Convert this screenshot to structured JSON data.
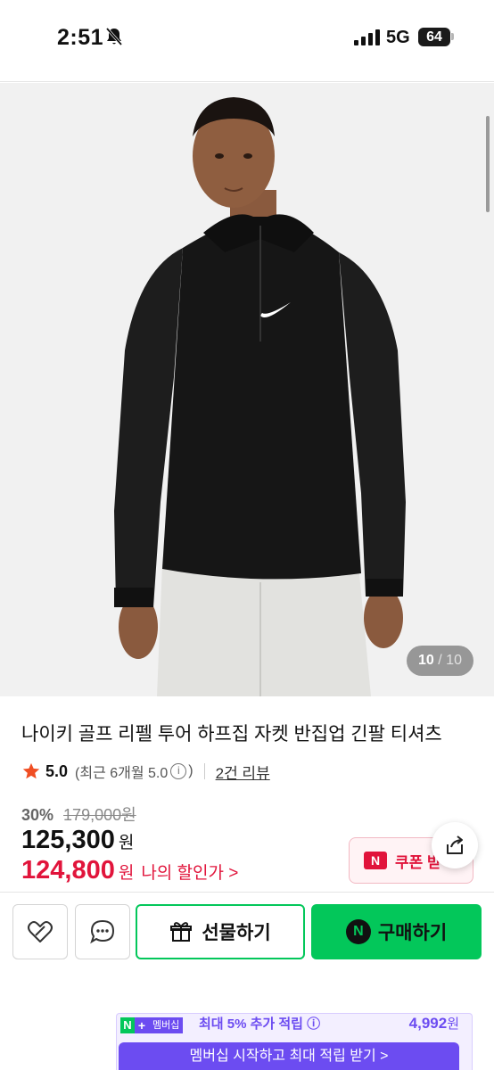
{
  "status_bar": {
    "time": "2:51",
    "network": "5G",
    "battery": "64"
  },
  "gallery": {
    "current": "10",
    "separator": " / ",
    "total": "10"
  },
  "product": {
    "title": "나이키 골프 리펠 투어 하프집 자켓 반집업 긴팔 티셔츠",
    "rating": "5.0",
    "rating_recent": "(최근 6개월 5.0",
    "rating_recent_close": ")",
    "review_link": "2건 리뷰",
    "discount_rate": "30%",
    "original_price": "179,000원",
    "sale_price": "125,300",
    "sale_unit": "원",
    "my_price": "124,800",
    "my_unit": "원",
    "my_price_label": "나의 할인가 >"
  },
  "coupon": {
    "badge": "N",
    "label": "쿠폰 받"
  },
  "actions": {
    "gift_label": "선물하기",
    "buy_label": "구매하기",
    "npay_badge": "N"
  },
  "membership": {
    "badge_n": "N",
    "badge_plus": "+",
    "badge_label": "멤버십",
    "text": "최대 5% 추가 적립 ⓘ",
    "points": "4,992",
    "points_unit": "원",
    "cta": "멤버십 시작하고 최대 적립 받기 >"
  },
  "colors": {
    "naver_green": "#03c75a",
    "price_red": "#e1143b",
    "membership_purple": "#6c4cf1",
    "star_orange": "#f04e23"
  },
  "icons": [
    "bell-slash-icon",
    "signal-icon",
    "star-icon",
    "info-icon",
    "share-icon",
    "heart-link-icon",
    "chat-icon",
    "gift-icon"
  ]
}
